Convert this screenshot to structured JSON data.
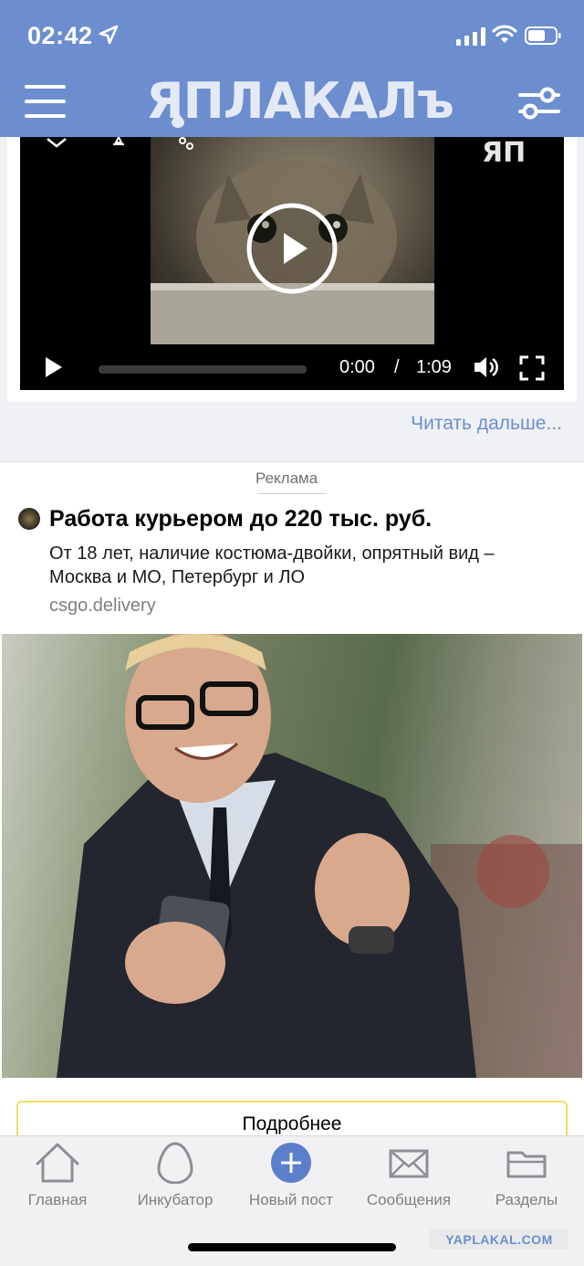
{
  "status_bar": {
    "time": "02:42"
  },
  "header": {
    "logo_text": "ЯПЛАКАЛъ",
    "brand_color": "#6c8ecf"
  },
  "post": {
    "video": {
      "watermark": "ЯП",
      "current_time": "0:00",
      "separator": "/",
      "duration": "1:09",
      "progress": 0
    },
    "read_more": "Читать дальше..."
  },
  "ad": {
    "label": "Реклама",
    "title": "Работа курьером до 220 тыс. руб.",
    "description": "От 18 лет, наличие костюма-двойки, опрятный вид – Москва и МО, Петербург и ЛО",
    "domain": "csgo.delivery",
    "button": "Подробнее",
    "button_border_color": "#ecdc6c"
  },
  "tabbar": {
    "items": [
      {
        "label": "Главная",
        "icon": "home-icon"
      },
      {
        "label": "Инкубатор",
        "icon": "egg-icon"
      },
      {
        "label": "Новый пост",
        "icon": "plus-icon"
      },
      {
        "label": "Сообщения",
        "icon": "envelope-icon"
      },
      {
        "label": "Разделы",
        "icon": "folder-icon"
      }
    ]
  },
  "site_watermark": "YAPLAKAL.COM"
}
